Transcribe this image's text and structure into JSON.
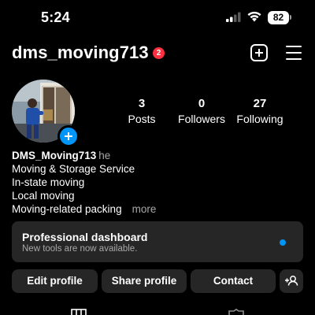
{
  "status_bar": {
    "time": "5:24",
    "battery": "82",
    "signal_icon": "cellular-signal-icon",
    "wifi_icon": "wifi-icon"
  },
  "header": {
    "username": "dms_moving713",
    "notification_count": "2",
    "create_icon": "plus-square-icon",
    "menu_icon": "hamburger-menu-icon"
  },
  "profile": {
    "stats": [
      {
        "count": "3",
        "label": "Posts"
      },
      {
        "count": "0",
        "label": "Followers"
      },
      {
        "count": "27",
        "label": "Following"
      }
    ],
    "display_name": "DMS_Moving713",
    "pronoun": "he",
    "bio_lines": [
      "Moving & Storage Service",
      "In-state moving",
      "Local moving",
      "Moving-related packing"
    ],
    "more_label": "more"
  },
  "dashboard": {
    "title": "Professional dashboard",
    "subtitle": "New tools are now available."
  },
  "actions": {
    "edit_profile": "Edit profile",
    "share_profile": "Share profile",
    "contact": "Contact",
    "discover_icon": "add-person-icon"
  },
  "colors": {
    "background": "#000000",
    "surface": "#262626",
    "accent_blue": "#0095f6",
    "badge_red": "#ff3040",
    "secondary_text": "#a8a8a8"
  }
}
